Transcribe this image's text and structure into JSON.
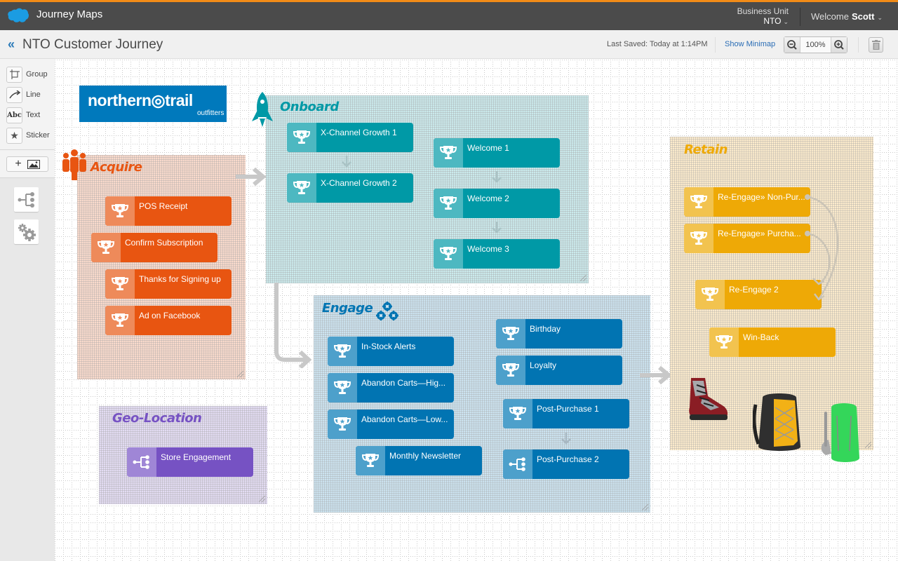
{
  "app": {
    "title": "Journey Maps",
    "business_unit_label": "Business Unit",
    "business_unit_value": "NTO",
    "welcome_label": "Welcome",
    "user_name": "Scott"
  },
  "subheader": {
    "back_icon": "double-chevron-left",
    "page_title": "NTO Customer Journey",
    "last_saved": "Last Saved: Today at 1:14PM",
    "show_minimap": "Show Minimap",
    "zoom_value": "100%"
  },
  "toolbar": {
    "tools": [
      {
        "label": "Group",
        "icon": "group-square"
      },
      {
        "label": "Line",
        "icon": "curved-arrow"
      },
      {
        "label": "Text",
        "icon": "Abc"
      },
      {
        "label": "Sticker",
        "icon": "star"
      }
    ],
    "add_image_plus": "+",
    "bottom_buttons": [
      "hierarchy-icon",
      "gears-icon"
    ]
  },
  "logo": {
    "line1": "northern◎trail",
    "line2": "outfitters",
    "color": "#0079bc"
  },
  "groups": {
    "acquire": {
      "title": "Acquire",
      "icon": "people-icon",
      "color": "#e85511",
      "bg": "#f9dacc",
      "cards": [
        "POS Receipt",
        "Confirm Subscription",
        "Thanks for Signing up",
        "Ad on Facebook"
      ]
    },
    "onboard": {
      "title": "Onboard",
      "icon": "rocket-icon",
      "color": "#0099a6",
      "bg": "#cbeaec",
      "cards": [
        "X-Channel Growth 1",
        "X-Channel Growth 2",
        "Welcome 1",
        "Welcome 2",
        "Welcome 3"
      ]
    },
    "engage": {
      "title": "Engage",
      "icon": "gears-icon",
      "color": "#0174b2",
      "bg": "#cce3f0",
      "cards": [
        "In-Stock Alerts",
        "Abandon Carts—Hig...",
        "Abandon Carts—Low...",
        "Monthly Newsletter",
        "Birthday",
        "Loyalty",
        "Post-Purchase 1",
        "Post-Purchase 2"
      ]
    },
    "retain": {
      "title": "Retain",
      "color": "#eea906",
      "bg": "#fcebcc",
      "cards": [
        "Re-Engage» Non-Pur...",
        "Re-Engage» Purcha...",
        "Re-Engage 2",
        "Win-Back"
      ],
      "stickers": [
        "hiking-boot",
        "yellow-backpack",
        "green-backpack"
      ]
    },
    "geo": {
      "title": "Geo-Location",
      "color": "#7652c3",
      "bg": "#e3dcf3",
      "cards": [
        "Store Engagement"
      ]
    }
  }
}
